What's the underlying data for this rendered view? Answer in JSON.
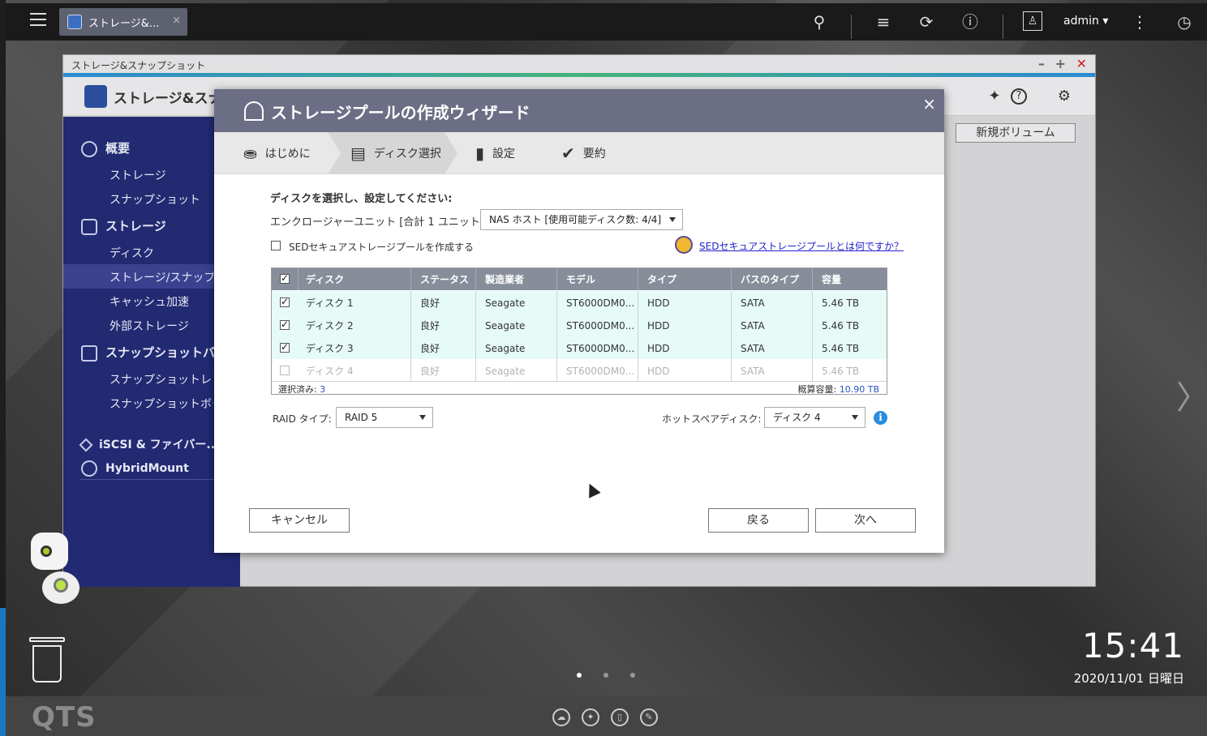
{
  "topbar": {
    "app_tab_label": "ストレージ&...",
    "tab_close": "×",
    "user": "admin",
    "user_caret": "▾"
  },
  "appwin": {
    "title": "ストレージ&スナップショット",
    "header_title": "ストレージ&スナップショット",
    "new_volume_label": "新規ボリューム",
    "sidebar": {
      "overview": "概要",
      "storage_sub": "ストレージ",
      "snapshot_sub": "スナップショット",
      "storage_group": "ストレージ",
      "disk": "ディスク",
      "storage_snapshot": "ストレージ/スナップショット",
      "cache": "キャッシュ加速",
      "external": "外部ストレージ",
      "snapshot_backup": "スナップショットバ...",
      "snapshot_replica": "スナップショットレプリカ",
      "snapshot_vault": "スナップショットボールト",
      "iscsi": "iSCSI & ファイバー...",
      "hybridmount": "HybridMount"
    }
  },
  "wizard": {
    "title": "ストレージプールの作成ウィザード",
    "close": "×",
    "steps": [
      "はじめに",
      "ディスク選択",
      "設定",
      "要約"
    ],
    "instruction": "ディスクを選択し、設定してください:",
    "enclosure_label": "エンクロージャーユニット [合計 1 ユニット]:",
    "enclosure_value": "NAS ホスト [使用可能ディスク数: 4/4]",
    "sed_label": "SEDセキュアストレージプールを作成する",
    "sed_help_link": "SEDセキュアストレージプールとは何ですか？",
    "table": {
      "headers": [
        "ディスク",
        "ステータス",
        "製造業者",
        "モデル",
        "タイプ",
        "バスのタイプ",
        "容量"
      ],
      "rows": [
        {
          "disk": "ディスク 1",
          "status": "良好",
          "maker": "Seagate",
          "model": "ST6000DM0...",
          "type": "HDD",
          "bus": "SATA",
          "capacity": "5.46 TB",
          "checked": true
        },
        {
          "disk": "ディスク 2",
          "status": "良好",
          "maker": "Seagate",
          "model": "ST6000DM0...",
          "type": "HDD",
          "bus": "SATA",
          "capacity": "5.46 TB",
          "checked": true
        },
        {
          "disk": "ディスク 3",
          "status": "良好",
          "maker": "Seagate",
          "model": "ST6000DM0...",
          "type": "HDD",
          "bus": "SATA",
          "capacity": "5.46 TB",
          "checked": true
        },
        {
          "disk": "ディスク 4",
          "status": "良好",
          "maker": "Seagate",
          "model": "ST6000DM0...",
          "type": "HDD",
          "bus": "SATA",
          "capacity": "5.46 TB",
          "checked": false
        }
      ],
      "selected_label": "選択済み: ",
      "selected_count": "3",
      "estimated_label": "概算容量: ",
      "estimated_value": "10.90 TB"
    },
    "raid_label": "RAID タイプ:",
    "raid_value": "RAID 5",
    "hotspare_label": "ホットスペアディスク:",
    "hotspare_value": "ディスク 4",
    "info_glyph": "i",
    "cancel": "キャンセル",
    "back": "戻る",
    "next": "次へ"
  },
  "desktop": {
    "time": "15:41",
    "date": "2020/11/01 日曜日",
    "logo": "QTS",
    "next_arrow": "〉"
  },
  "colors": {
    "sidebar_bg": "#222a72",
    "wizard_header": "#6c6e85",
    "table_header": "#878e9a",
    "selected_row": "#e6fbf7",
    "accent_blue": "#2a56c6"
  }
}
